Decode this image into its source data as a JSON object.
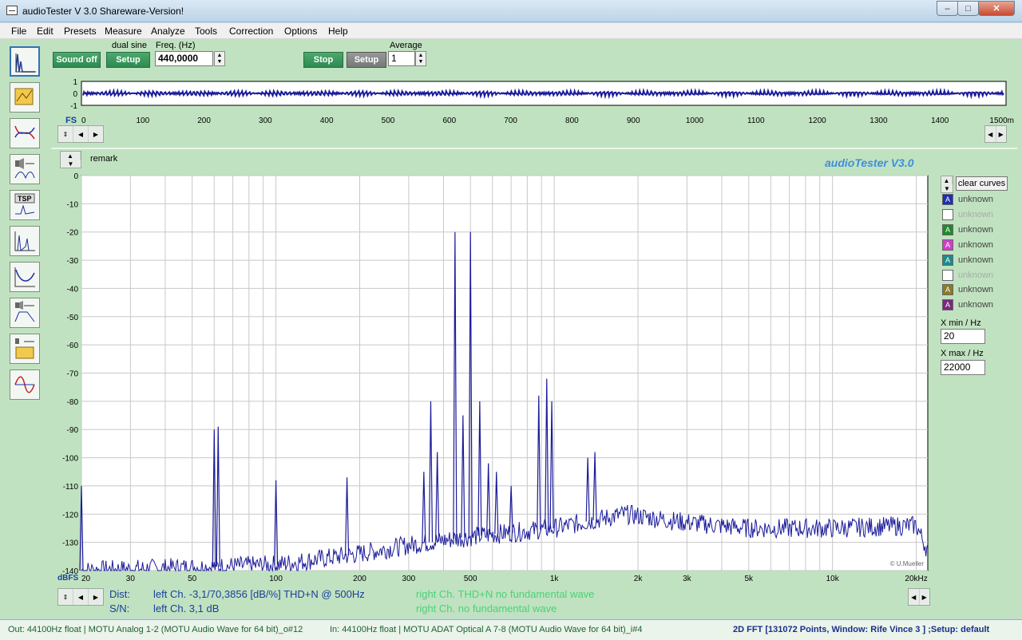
{
  "window": {
    "title": "audioTester  V 3.0 Shareware-Version!",
    "min_glyph": "–",
    "max_glyph": "□",
    "close_glyph": "✕"
  },
  "menu": [
    "File",
    "Edit",
    "Presets",
    "Measure",
    "Analyze",
    "Tools",
    "Correction",
    "Options",
    "Help"
  ],
  "generator": {
    "sound_button": "Sound off",
    "mode_label": "dual sine",
    "setup_button": "Setup",
    "freq_label": "Freq. (Hz)",
    "freq_value": "440,0000"
  },
  "analyzer": {
    "stop_button": "Stop",
    "setup_button": "Setup",
    "average_label": "Average",
    "average_value": "1"
  },
  "scope": {
    "fs_label": "FS",
    "y_ticks": [
      "1",
      "0",
      "-1"
    ],
    "x_ticks": [
      "0",
      "100",
      "200",
      "300",
      "400",
      "500",
      "600",
      "700",
      "800",
      "900",
      "1000",
      "1100",
      "1200",
      "1300",
      "1400",
      "1500m"
    ]
  },
  "fft": {
    "remark_label": "remark",
    "brand": "audioTester  V3.0",
    "credit": "© U.Mueller",
    "y_unit": "dBFS",
    "dist_label": "Dist:",
    "dist_left": "left Ch. -3,1/70,3856 [dB/%] THD+N  @ 500Hz",
    "dist_right": "right Ch. THD+N  no fundamental wave",
    "sn_label": "S/N:",
    "sn_left": "left Ch. 3,1 dB",
    "sn_right": "right Ch.  no fundamental wave"
  },
  "chart_data": {
    "type": "line",
    "title": "",
    "xlabel": "",
    "ylabel": "dBFS",
    "x_scale": "log",
    "xlim": [
      20,
      22000
    ],
    "ylim": [
      -140,
      0
    ],
    "grid": true,
    "x_tick_labels": [
      "20",
      "30",
      "50",
      "100",
      "200",
      "300",
      "500",
      "1k",
      "2k",
      "3k",
      "5k",
      "10k",
      "20kHz"
    ],
    "x_tick_values": [
      20,
      30,
      50,
      100,
      200,
      300,
      500,
      1000,
      2000,
      3000,
      5000,
      10000,
      20000
    ],
    "y_ticks": [
      0,
      -10,
      -20,
      -30,
      -40,
      -50,
      -60,
      -70,
      -80,
      -90,
      -100,
      -110,
      -120,
      -130,
      -140
    ],
    "series": [
      {
        "color": "#1b1b9a",
        "peaks": [
          {
            "x": 20,
            "y": -110
          },
          {
            "x": 60,
            "y": -90
          },
          {
            "x": 62,
            "y": -89
          },
          {
            "x": 100,
            "y": -108
          },
          {
            "x": 180,
            "y": -107
          },
          {
            "x": 340,
            "y": -105
          },
          {
            "x": 360,
            "y": -80
          },
          {
            "x": 380,
            "y": -98
          },
          {
            "x": 440,
            "y": -20
          },
          {
            "x": 470,
            "y": -85
          },
          {
            "x": 500,
            "y": -20
          },
          {
            "x": 540,
            "y": -80
          },
          {
            "x": 580,
            "y": -102
          },
          {
            "x": 620,
            "y": -105
          },
          {
            "x": 700,
            "y": -110
          },
          {
            "x": 880,
            "y": -78
          },
          {
            "x": 940,
            "y": -72
          },
          {
            "x": 980,
            "y": -80
          },
          {
            "x": 1320,
            "y": -100
          },
          {
            "x": 1400,
            "y": -98
          }
        ],
        "floor": [
          {
            "x": 20,
            "y": -140
          },
          {
            "x": 100,
            "y": -138
          },
          {
            "x": 200,
            "y": -134
          },
          {
            "x": 300,
            "y": -131
          },
          {
            "x": 500,
            "y": -128
          },
          {
            "x": 1000,
            "y": -125
          },
          {
            "x": 1800,
            "y": -120
          },
          {
            "x": 3000,
            "y": -123
          },
          {
            "x": 5000,
            "y": -125
          },
          {
            "x": 10000,
            "y": -125
          },
          {
            "x": 20000,
            "y": -124
          },
          {
            "x": 22000,
            "y": -133
          }
        ]
      }
    ]
  },
  "channels": {
    "clear_button": "clear curves",
    "items": [
      {
        "label": "unknown",
        "color": "#1c2fb0",
        "dim": false
      },
      {
        "label": "unknown",
        "color": "#ffffff",
        "dim": true
      },
      {
        "label": "unknown",
        "color": "#1e8a2a",
        "dim": false
      },
      {
        "label": "unknown",
        "color": "#d040c8",
        "dim": false
      },
      {
        "label": "unknown",
        "color": "#1f8a8a",
        "dim": false
      },
      {
        "label": "unknown",
        "color": "#ffffff",
        "dim": true
      },
      {
        "label": "unknown",
        "color": "#8a7a28",
        "dim": false
      },
      {
        "label": "unknown",
        "color": "#7a2a7a",
        "dim": false
      }
    ],
    "xmin_label": "X min / Hz",
    "xmin_value": "20",
    "xmax_label": "X max / Hz",
    "xmax_value": "22000"
  },
  "status": {
    "out": "Out: 44100Hz float  | MOTU Analog 1-2 (MOTU Audio Wave for 64 bit)_o#12",
    "in": "In: 44100Hz float  | MOTU ADAT Optical A 7-8 (MOTU Audio Wave for 64 bit)_i#4",
    "mode": "2D FFT  [131072 Points, Window: Rife Vince 3 ]  ;Setup:  default"
  }
}
